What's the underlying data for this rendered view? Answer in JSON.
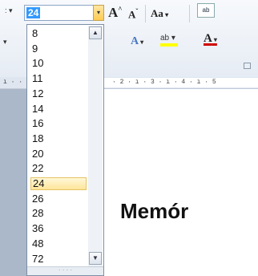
{
  "font_size": {
    "current_value": "24",
    "options": [
      "8",
      "9",
      "10",
      "11",
      "12",
      "14",
      "16",
      "18",
      "20",
      "22",
      "24",
      "26",
      "28",
      "36",
      "48",
      "72"
    ],
    "selected": "24"
  },
  "toolbar": {
    "grow_font_label": "A",
    "shrink_font_label": "A",
    "change_case_label": "Aa",
    "clear_formatting_label": "ab",
    "text_effects_label": "A",
    "highlight_label": "ab",
    "font_color_label": "A"
  },
  "ruler": {
    "labels": "· 2 · ı · 3 · ı · 4 · ı · 5"
  },
  "document": {
    "visible_text": "Memór"
  },
  "colors": {
    "accent_selection": "#3399ff",
    "highlight_yellow": "#ffff00",
    "font_color_red": "#d00000",
    "hover_orange": "#ffcb53"
  },
  "icons": {
    "dropdown_caret": "▾",
    "scroll_up": "▲",
    "scroll_down": "▼",
    "dialog_launcher": "↘"
  }
}
